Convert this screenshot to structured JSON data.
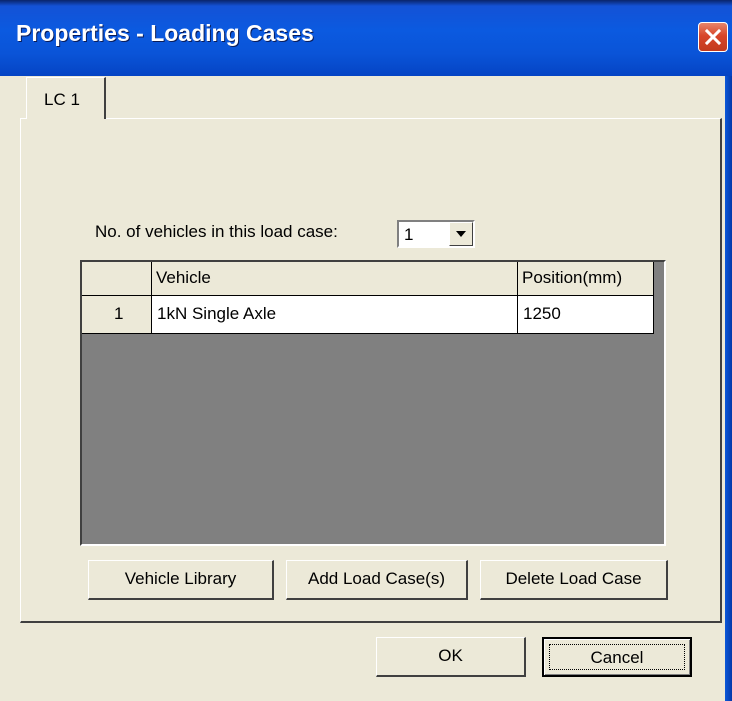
{
  "window": {
    "title": "Properties - Loading Cases"
  },
  "tabs": [
    {
      "label": "LC 1"
    }
  ],
  "load_case": {
    "count_label": "No. of vehicles in this load case:",
    "count_value": "1"
  },
  "table": {
    "columns": [
      "",
      "Vehicle",
      "Position(mm)"
    ],
    "rows": [
      {
        "index": "1",
        "vehicle": "1kN Single Axle",
        "position": "1250"
      }
    ]
  },
  "buttons": {
    "vehicle_library": "Vehicle Library",
    "add_load_case": "Add Load Case(s)",
    "delete_load_case": "Delete Load Case",
    "ok": "OK",
    "cancel": "Cancel"
  },
  "colors": {
    "titlebar": "#0b5ae0",
    "face": "#ece9d8",
    "grid_bg": "#808080",
    "close": "#d8462a"
  }
}
